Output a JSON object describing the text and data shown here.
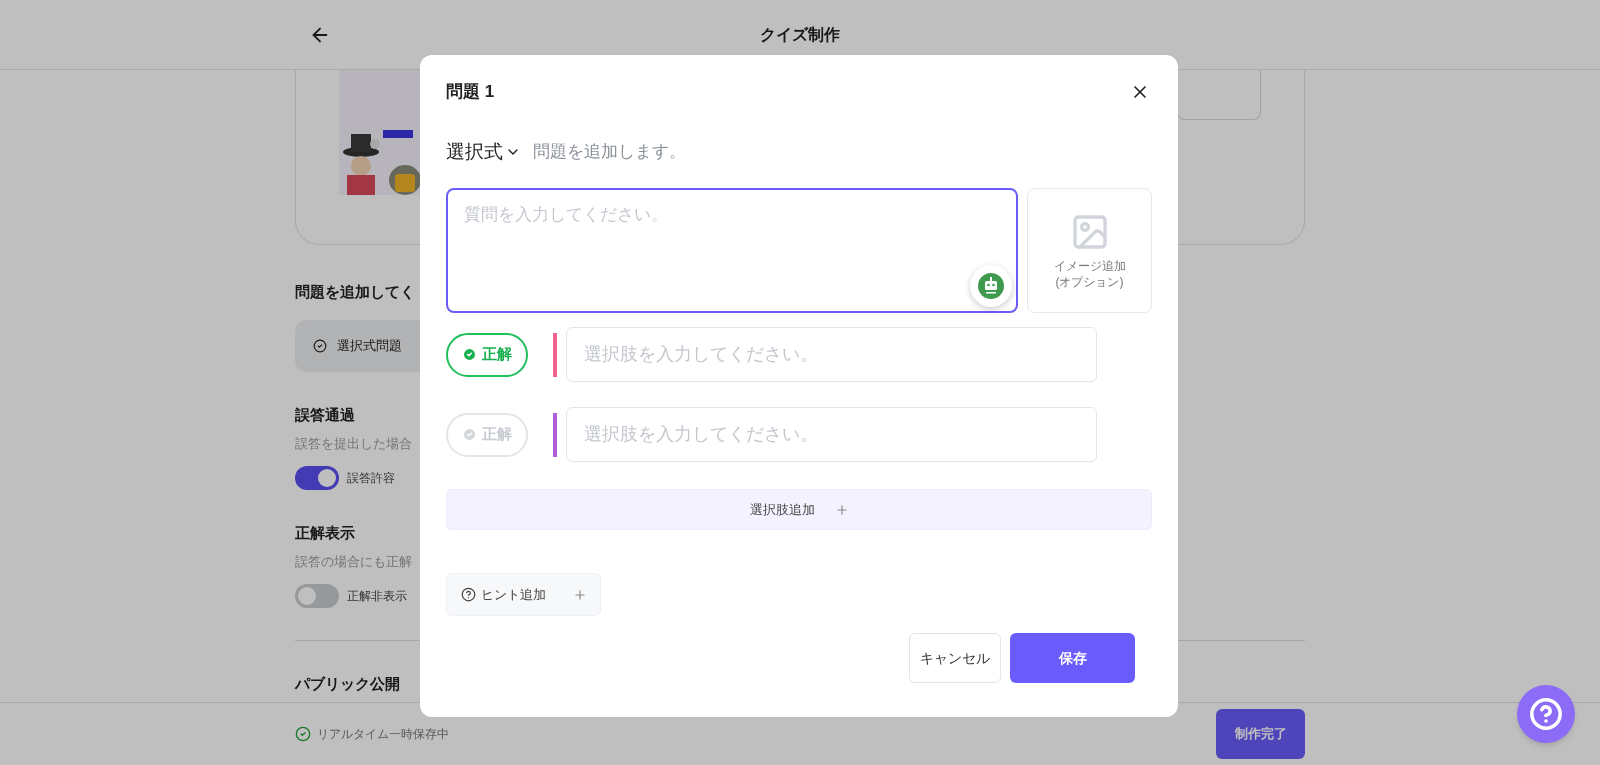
{
  "header": {
    "title": "クイズ制作"
  },
  "page": {
    "section_title": "問題を追加してく",
    "question_type": {
      "label": "選択式問題"
    },
    "settings": [
      {
        "title": "誤答通過",
        "description": "誤答を提出した場合",
        "toggle_label": "誤答許容",
        "on": true
      },
      {
        "title": "正解表示",
        "description": "誤答の場合にも正解",
        "toggle_label": "正解非表示",
        "on": false
      }
    ],
    "public_title": "パブリック公開"
  },
  "footer": {
    "save_status": "リアルタイム一時保存中",
    "finish_button": "制作完了"
  },
  "modal": {
    "title": "問題 1",
    "type_select": "選択式",
    "type_hint": "問題を追加します。",
    "question": {
      "placeholder": "質問を入力してください。"
    },
    "image_add": {
      "lines": [
        "イメージ追加",
        "(オプション)"
      ]
    },
    "options": [
      {
        "correct_label": "正解",
        "correct": true,
        "color": "#f0648c",
        "placeholder": "選択肢を入力してください。"
      },
      {
        "correct_label": "正解",
        "correct": false,
        "color": "#b15fd8",
        "placeholder": "選択肢を入力してください。"
      }
    ],
    "add_option": "選択肢追加",
    "add_hint": "ヒント追加",
    "cancel": "キャンセル",
    "save": "保存"
  }
}
